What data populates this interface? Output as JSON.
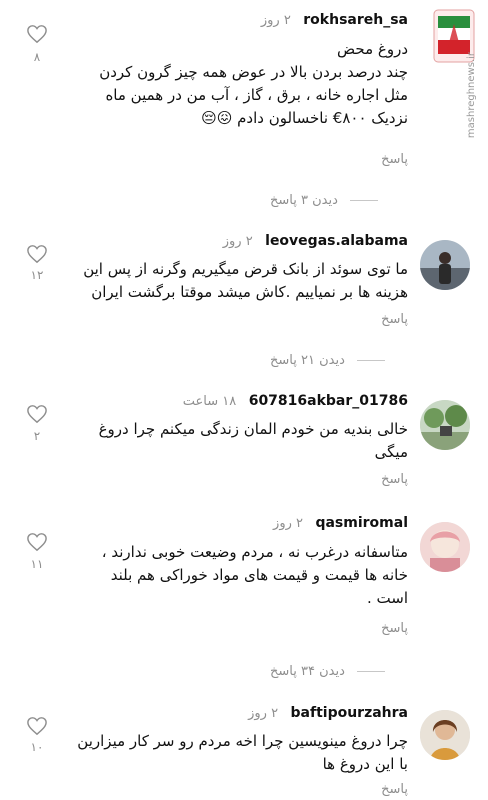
{
  "reply_label": "پاسخ",
  "comments": [
    {
      "username": "rokhsareh_sa",
      "time": "۲ روز",
      "lines": [
        "دروغ محض",
        "چند درصد بردن بالا در عوض همه چیز گرون کردن",
        "مثل اجاره خانه ، برق ، گاز ، آب من در همین ماه",
        "نزدیک ۸۰۰€ ناخسالون دادم 😖😔"
      ],
      "likes": "۸",
      "view_replies": "دیدن ۳ پاسخ"
    },
    {
      "username": "leovegas.alabama",
      "time": "۲ روز",
      "lines": [
        "ما توی سوئد از بانک قرض میگیریم وگرنه از پس این",
        "هزینه ها بر نمیاییم .کاش میشد موقتا برگشت ایران"
      ],
      "likes": "۱۲",
      "view_replies": "دیدن ۲۱ پاسخ"
    },
    {
      "username": "607816akbar_01786",
      "time": "۱۸ ساعت",
      "lines": [
        "خالی بندیه من خودم المان زندگی میکنم چرا دروغ",
        "میگی"
      ],
      "likes": "۲",
      "view_replies": ""
    },
    {
      "username": "qasmiromal",
      "time": "۲ روز",
      "lines": [
        "متاسفانه درغرب نه ، مردم وضیعت خوبی ندارند ،",
        "خانه ها قیمت و قیمت های مواد خوراکی هم بلند",
        "است ."
      ],
      "likes": "۱۱",
      "view_replies": "دیدن ۳۴ پاسخ"
    },
    {
      "username": "baftipourzahra",
      "time": "۲ روز",
      "lines": [
        "چرا دروغ مینویسین چرا اخه مردم رو سر کار میزارین",
        "با این دروغ ها"
      ],
      "likes": "۱۰",
      "view_replies": ""
    }
  ],
  "watermark": "mashreghnews.ir"
}
